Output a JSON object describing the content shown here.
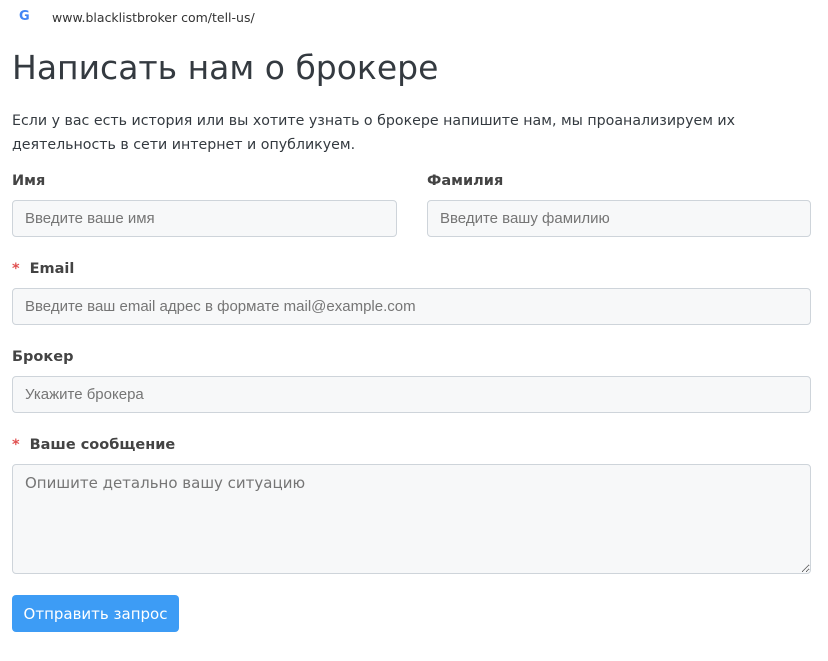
{
  "browser": {
    "url": "www.blacklistbroker com/tell-us/",
    "icon": "google-icon"
  },
  "title": "Написать нам о брокере",
  "description": "Если у вас есть история или вы хотите узнать о брокере напишите нам, мы проанализируем их деятельность в сети интернет и опубликуем.",
  "form": {
    "first_name": {
      "label": "Имя",
      "placeholder": "Введите ваше имя"
    },
    "last_name": {
      "label": "Фамилия",
      "placeholder": "Введите вашу фамилию"
    },
    "email": {
      "required": "*",
      "label": "Email",
      "placeholder": "Введите ваш email адрес в формате mail@example.com"
    },
    "broker": {
      "label": "Брокер",
      "placeholder": "Укажите брокера"
    },
    "message": {
      "required": "*",
      "label": "Ваше сообщение",
      "placeholder": "Опишите детально вашу ситуацию"
    },
    "submit": "Отправить запрос"
  }
}
